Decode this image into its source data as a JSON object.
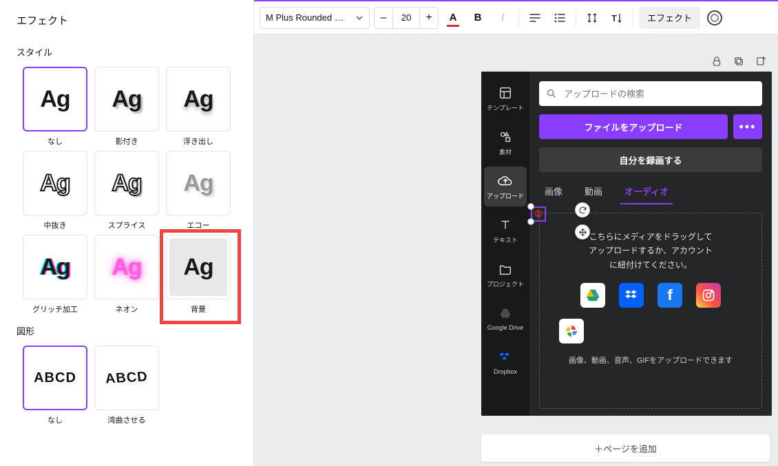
{
  "panel": {
    "title": "エフェクト",
    "style_label": "スタイル",
    "shape_label": "図形",
    "styles": [
      {
        "label": "なし"
      },
      {
        "label": "影付き"
      },
      {
        "label": "浮き出し"
      },
      {
        "label": "中抜き"
      },
      {
        "label": "スプライス"
      },
      {
        "label": "エコー"
      },
      {
        "label": "グリッチ加工"
      },
      {
        "label": "ネオン"
      },
      {
        "label": "背景"
      }
    ],
    "shapes": [
      {
        "label": "なし"
      },
      {
        "label": "湾曲させる"
      }
    ],
    "sample_ag": "Ag",
    "sample_abcd": "ABCD"
  },
  "toolbar": {
    "font_name": "M Plus Rounded …",
    "font_size": "20",
    "minus": "–",
    "plus": "+",
    "color_label": "A",
    "bold_label": "B",
    "italic_label": "I",
    "effects_label": "エフェクト"
  },
  "dark": {
    "side": {
      "template": "テンプレート",
      "elements": "素材",
      "uploads": "アップロード",
      "text": "テキスト",
      "projects": "プロジェクト",
      "gdrive": "Google Drive",
      "dropbox": "Dropbox"
    },
    "search_placeholder": "アップロードの検索",
    "upload_btn": "ファイルをアップロード",
    "more_btn": "•••",
    "record_btn": "自分を録画する",
    "tabs": {
      "image": "画像",
      "video": "動画",
      "audio": "オーディオ"
    },
    "drop_line1": "こちらにメディアをドラッグして",
    "drop_line2": "アップロードするか、アカウント",
    "drop_line3": "に紐付けてください。",
    "footer": "画像、動画、音声、GIFをアップロードできます"
  },
  "selection": {
    "number": "①"
  },
  "add_page": "＋ページを追加"
}
